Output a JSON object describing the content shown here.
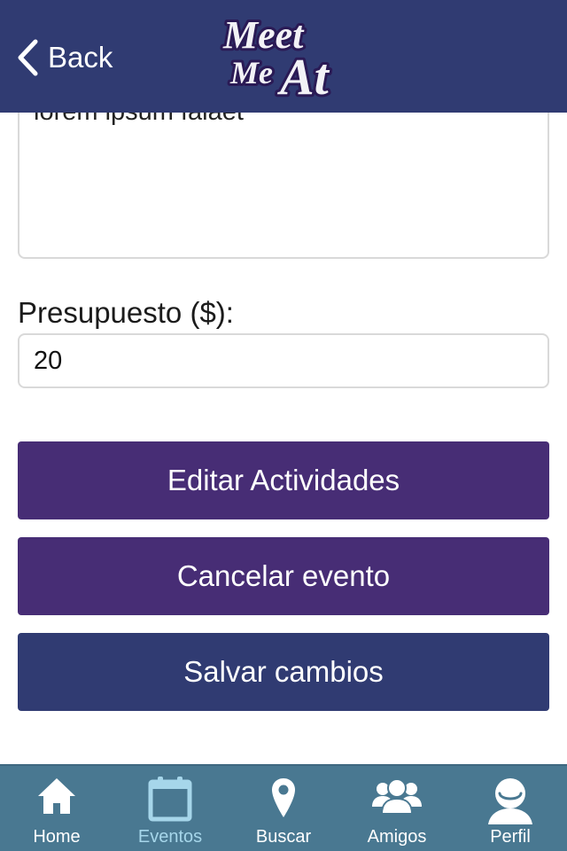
{
  "header": {
    "back_label": "Back",
    "logo_alt": "Meet Me At",
    "logo_lines": [
      "Meet",
      "Me",
      "At"
    ]
  },
  "form": {
    "description_value": "lorem ipsum falaet",
    "budget_label": "Presupuesto ($):",
    "budget_value": "20"
  },
  "buttons": {
    "edit_activities": "Editar Actividades",
    "cancel_event": "Cancelar evento",
    "save_changes": "Salvar cambios"
  },
  "tabs": [
    {
      "label": "Home",
      "icon": "home-icon",
      "active": false
    },
    {
      "label": "Eventos",
      "icon": "calendar-icon",
      "active": true
    },
    {
      "label": "Buscar",
      "icon": "map-pin-icon",
      "active": false
    },
    {
      "label": "Amigos",
      "icon": "friends-icon",
      "active": false
    },
    {
      "label": "Perfil",
      "icon": "user-icon",
      "active": false
    }
  ],
  "colors": {
    "header": "#303b72",
    "purple_button": "#472d75",
    "navy_button": "#303b72",
    "tabbar": "#497891",
    "active_tab": "#a6d6ea"
  }
}
